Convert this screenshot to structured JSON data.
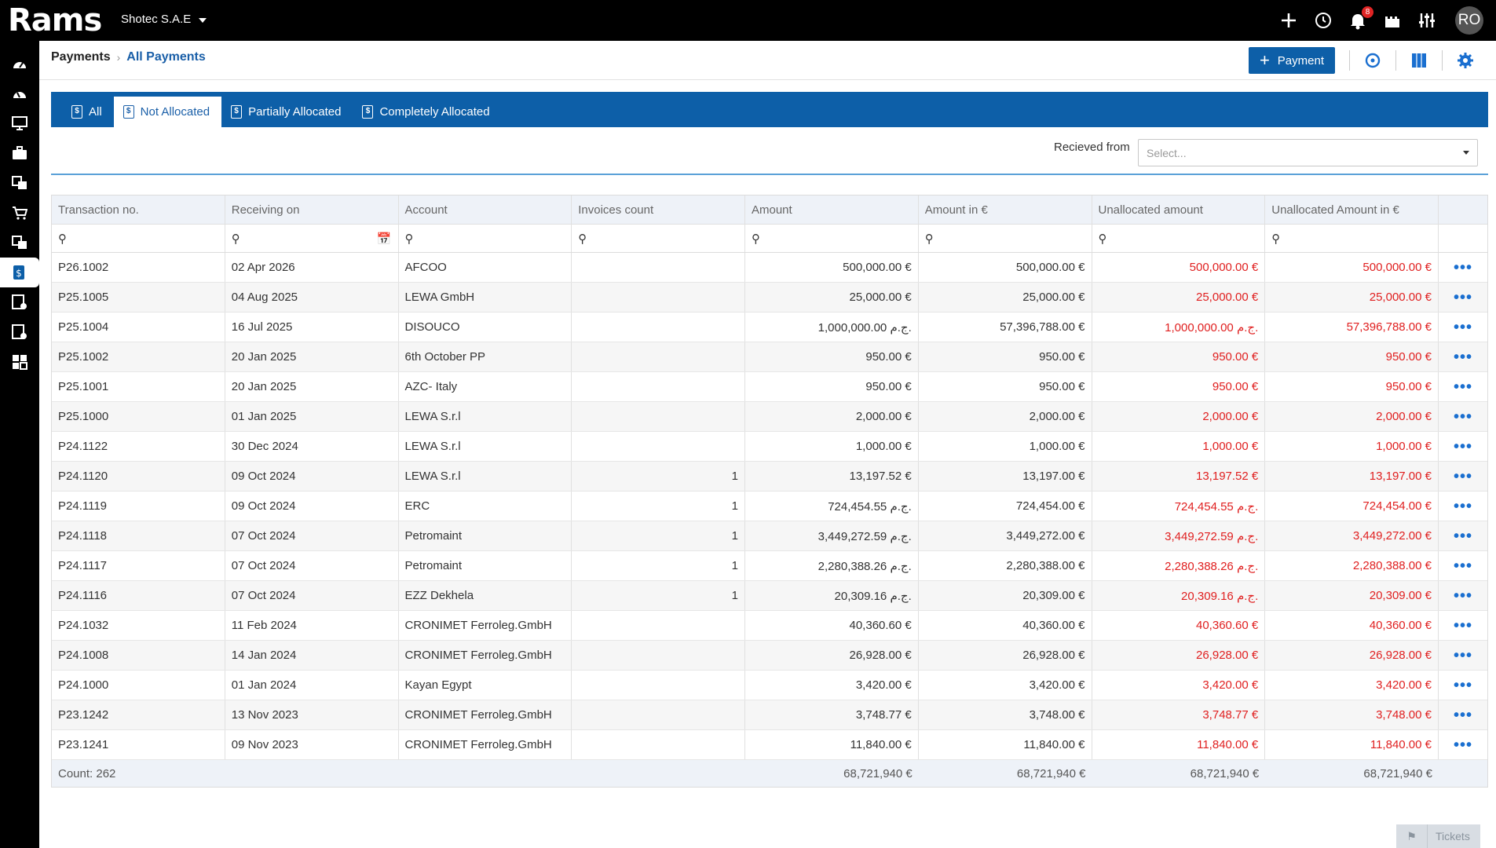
{
  "app": {
    "logo": "Rams",
    "org": "Shotec S.A.E",
    "notifications_count": "8",
    "avatar": "RO"
  },
  "breadcrumb": {
    "root": "Payments",
    "current": "All Payments"
  },
  "header": {
    "add_payment_label": "Payment"
  },
  "tabs": [
    {
      "label": "All"
    },
    {
      "label": "Not Allocated",
      "active": true
    },
    {
      "label": "Partially Allocated"
    },
    {
      "label": "Completely Allocated"
    }
  ],
  "filter": {
    "label": "Recieved from",
    "placeholder": "Select..."
  },
  "table": {
    "columns": [
      "Transaction no.",
      "Receiving on",
      "Account",
      "Invoices count",
      "Amount",
      "Amount in €",
      "Unallocated amount",
      "Unallocated Amount in €"
    ],
    "rows": [
      [
        "P26.1002",
        "02 Apr 2026",
        "AFCOO",
        "",
        "500,000.00 €",
        "500,000.00 €",
        "500,000.00 €",
        "500,000.00 €"
      ],
      [
        "P25.1005",
        "04 Aug 2025",
        "LEWA GmbH",
        "",
        "25,000.00 €",
        "25,000.00 €",
        "25,000.00 €",
        "25,000.00 €"
      ],
      [
        "P25.1004",
        "16 Jul 2025",
        "DISOUCO",
        "",
        "1,000,000.00 ج.م.",
        "57,396,788.00 €",
        "1,000,000.00 ج.م.",
        "57,396,788.00 €"
      ],
      [
        "P25.1002",
        "20 Jan 2025",
        "6th October PP",
        "",
        "950.00 €",
        "950.00 €",
        "950.00 €",
        "950.00 €"
      ],
      [
        "P25.1001",
        "20 Jan 2025",
        "AZC- Italy",
        "",
        "950.00 €",
        "950.00 €",
        "950.00 €",
        "950.00 €"
      ],
      [
        "P25.1000",
        "01 Jan 2025",
        "LEWA S.r.l",
        "",
        "2,000.00 €",
        "2,000.00 €",
        "2,000.00 €",
        "2,000.00 €"
      ],
      [
        "P24.1122",
        "30 Dec 2024",
        "LEWA S.r.l",
        "",
        "1,000.00 €",
        "1,000.00 €",
        "1,000.00 €",
        "1,000.00 €"
      ],
      [
        "P24.1120",
        "09 Oct 2024",
        "LEWA S.r.l",
        "1",
        "13,197.52 €",
        "13,197.00 €",
        "13,197.52 €",
        "13,197.00 €"
      ],
      [
        "P24.1119",
        "09 Oct 2024",
        "ERC",
        "1",
        "724,454.55 ج.م.",
        "724,454.00 €",
        "724,454.55 ج.م.",
        "724,454.00 €"
      ],
      [
        "P24.1118",
        "07 Oct 2024",
        "Petromaint",
        "1",
        "3,449,272.59 ج.م.",
        "3,449,272.00 €",
        "3,449,272.59 ج.م.",
        "3,449,272.00 €"
      ],
      [
        "P24.1117",
        "07 Oct 2024",
        "Petromaint",
        "1",
        "2,280,388.26 ج.م.",
        "2,280,388.00 €",
        "2,280,388.26 ج.م.",
        "2,280,388.00 €"
      ],
      [
        "P24.1116",
        "07 Oct 2024",
        "EZZ Dekhela",
        "1",
        "20,309.16 ج.م.",
        "20,309.00 €",
        "20,309.16 ج.م.",
        "20,309.00 €"
      ],
      [
        "P24.1032",
        "11 Feb 2024",
        "CRONIMET Ferroleg.GmbH",
        "",
        "40,360.60 €",
        "40,360.00 €",
        "40,360.60 €",
        "40,360.00 €"
      ],
      [
        "P24.1008",
        "14 Jan 2024",
        "CRONIMET Ferroleg.GmbH",
        "",
        "26,928.00 €",
        "26,928.00 €",
        "26,928.00 €",
        "26,928.00 €"
      ],
      [
        "P24.1000",
        "01 Jan 2024",
        "Kayan Egypt",
        "",
        "3,420.00 €",
        "3,420.00 €",
        "3,420.00 €",
        "3,420.00 €"
      ],
      [
        "P23.1242",
        "13 Nov 2023",
        "CRONIMET Ferroleg.GmbH",
        "",
        "3,748.77 €",
        "3,748.00 €",
        "3,748.77 €",
        "3,748.00 €"
      ],
      [
        "P23.1241",
        "09 Nov 2023",
        "CRONIMET Ferroleg.GmbH",
        "",
        "11,840.00 €",
        "11,840.00 €",
        "11,840.00 €",
        "11,840.00 €"
      ]
    ],
    "footer": {
      "count": "Count: 262",
      "amount": "68,721,940 €",
      "amount_eur": "68,721,940 €",
      "unallocated": "68,721,940 €",
      "unallocated_eur": "68,721,940 €"
    }
  },
  "tickets_label": "Tickets",
  "colors": {
    "brand_blue": "#0d5fa8",
    "link_blue": "#1a5fa8",
    "unallocated_red": "#e02020"
  }
}
